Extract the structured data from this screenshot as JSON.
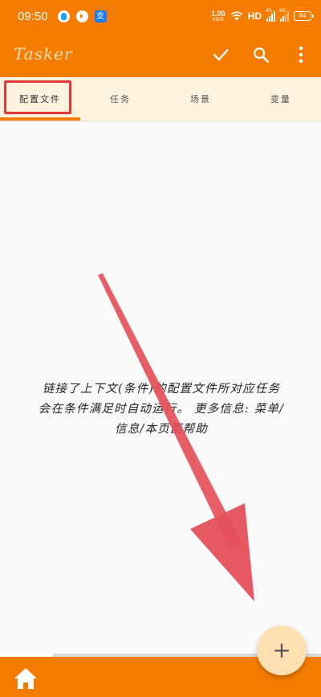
{
  "status_bar": {
    "time": "09:50",
    "net_speed": "1.00",
    "net_unit": "KB/S",
    "hd": "HD",
    "signal1": "4G",
    "signal2": "4G",
    "battery": "84",
    "alipay": "支",
    "notification_icons": [
      "qq-icon",
      "play-icon",
      "alipay-icon"
    ]
  },
  "app_bar": {
    "title": "Tasker",
    "actions": [
      "check-icon",
      "search-icon",
      "more-vert-icon"
    ]
  },
  "tabs": [
    {
      "label": "配置文件",
      "active": true
    },
    {
      "label": "任务",
      "active": false
    },
    {
      "label": "场景",
      "active": false
    },
    {
      "label": "变量",
      "active": false
    }
  ],
  "empty_state": {
    "line1": "链接了上下文(条件)的配置文件所对应任务",
    "line2": "会在条件满足时自动运行。 更多信息: 菜单/",
    "line3": "信息/本页面帮助"
  },
  "fab": {
    "label": "+"
  },
  "bottom_bar": {
    "icon": "home-icon"
  },
  "colors": {
    "primary": "#f57c00",
    "tab_bg": "#fff3e0",
    "highlight": "#e53935",
    "fab_bg": "#ffe0b2",
    "arrow": "#e5505a"
  }
}
